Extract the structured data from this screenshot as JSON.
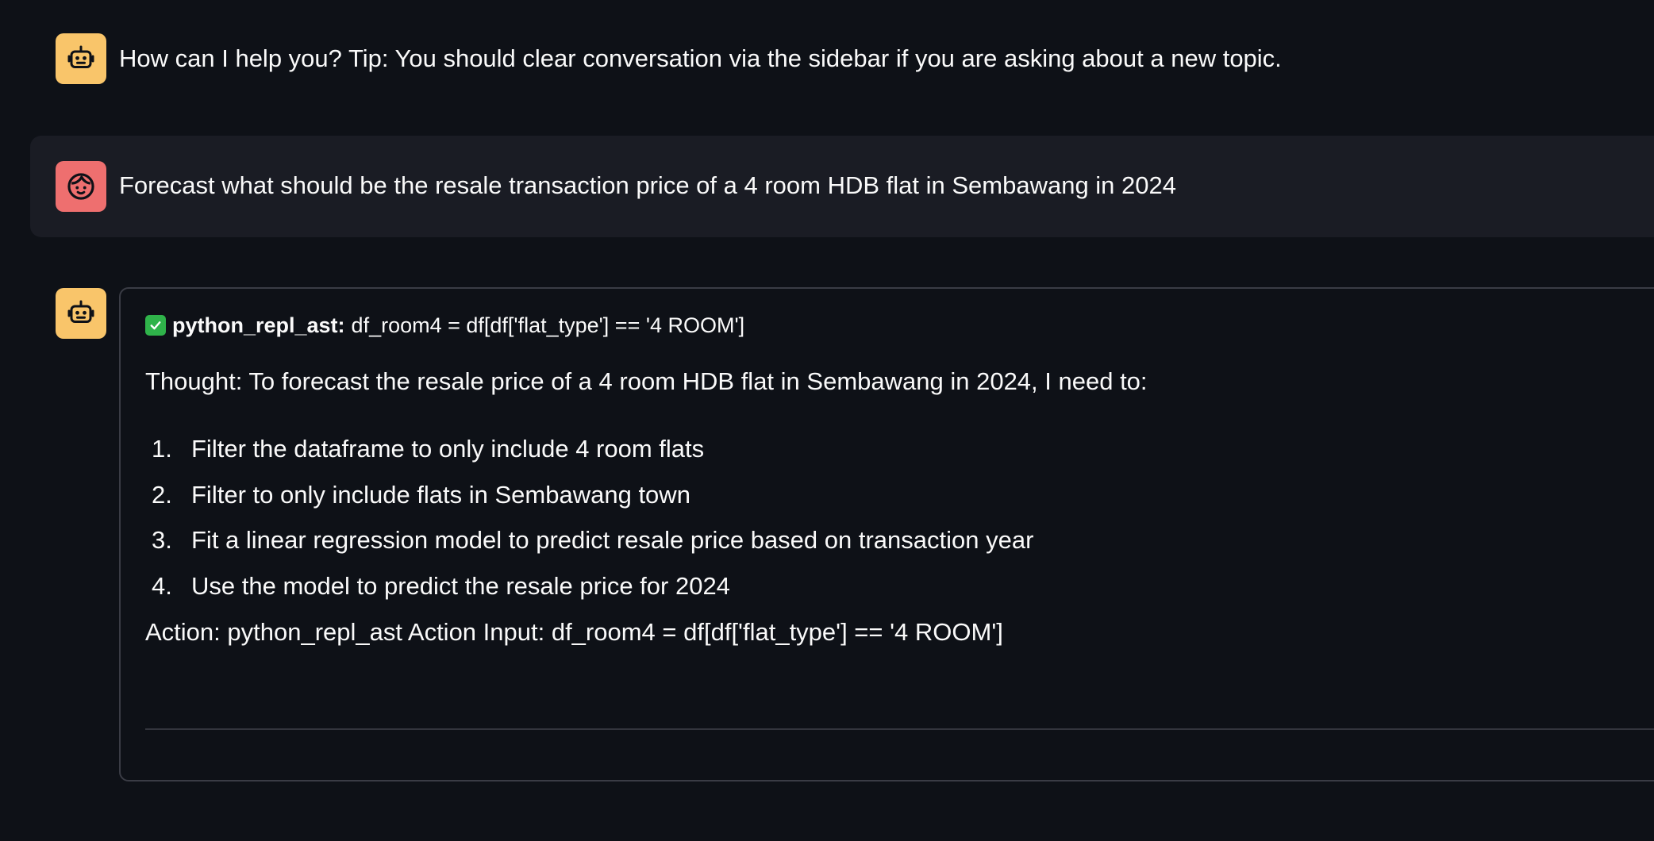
{
  "messages": {
    "assistant_intro": {
      "avatar_icon": "robot-icon",
      "text": "How can I help you? Tip: You should clear conversation via the sidebar if you are asking about a new topic."
    },
    "user_query": {
      "avatar_icon": "user-face-icon",
      "text": "Forecast what should be the resale transaction price of a 4 room HDB flat in Sembawang in 2024"
    },
    "assistant_response": {
      "avatar_icon": "robot-icon",
      "tool_call": {
        "status_icon": "check-mark-icon",
        "tool_name": "python_repl_ast:",
        "tool_input": "df_room4 = df[df['flat_type'] == '4 ROOM']"
      },
      "thought": "Thought: To forecast the resale price of a 4 room HDB flat in Sembawang in 2024, I need to:",
      "steps": [
        {
          "num": "1.",
          "label": "Filter the dataframe to only include 4 room flats"
        },
        {
          "num": "2.",
          "label": "Filter to only include flats in Sembawang town"
        },
        {
          "num": "3.",
          "label": "Fit a linear regression model to predict resale price based on transaction year"
        },
        {
          "num": "4.",
          "label": "Use the model to predict the resale price for 2024"
        }
      ],
      "action": "Action: python_repl_ast Action Input: df_room4 = df[df['flat_type'] == '4 ROOM']"
    }
  },
  "colors": {
    "background": "#0e1117",
    "user_row_background": "#1a1c24",
    "bot_avatar": "#f9c56a",
    "user_avatar": "#ee6f6f",
    "success_check": "#2fb34a",
    "text": "#fafafa"
  }
}
